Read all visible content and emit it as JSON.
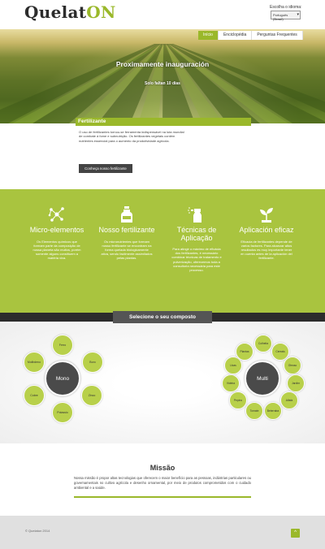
{
  "header": {
    "logo_prefix": "Quelat",
    "logo_suffix": "ON",
    "language_label": "Escolha o idioma:",
    "language_selected": "Português (Brasil)"
  },
  "nav": {
    "items": [
      {
        "label": "Início",
        "active": true
      },
      {
        "label": "Enciclopédia",
        "active": false
      },
      {
        "label": "Perguntas Frequentes",
        "active": false
      }
    ]
  },
  "hero": {
    "title": "Proximamente inauguración",
    "subtitle": "Solo faltan 10 días"
  },
  "fertilizante": {
    "title": "Fertilizante",
    "text": "O uso de fertilizantes tornou-se ferramenta indispensável na luta mundial de combate à fome e subnutrição. Os fertilizantes vegetais contém nutrientes essencial para o aumento da produtividade agrícola.",
    "button": "Conheça nosso fertilizante"
  },
  "features": [
    {
      "icon": "molecule-icon",
      "title": "Micro-elementos",
      "text": "Os Elementos químicos que formam parte da composição de nossa planeta são muitos, porém somente alguns constituem a matéria viva."
    },
    {
      "icon": "bottle-icon",
      "title": "Nosso fertilizante",
      "text": "Os micronutrientes que formam nosso fertilizante se encontram na forma quelada biologicamente ativa, sendo facilmente assimilados pelas plantas."
    },
    {
      "icon": "spray-icon",
      "title": "Técnicas de Aplicação",
      "text": "Para atingir o máximo de eficácia dos fertilizantes, é necessário combinar técnicas de tratamento e pulverização, oferecemos toda a consultoria necessária para este processo."
    },
    {
      "icon": "plant-icon",
      "title": "Aplicación eficaz",
      "text": "Eficacia de fertilizantes depende de varios factores. Para alcanzar altos resultados es muy importante tener en cuenta antes de la aplicación del fertilizante."
    }
  ],
  "compose": {
    "title": "Selecione o seu composto",
    "mono": {
      "label": "Mono",
      "items": [
        "Ferro",
        "Boro",
        "Zinco",
        "Potassio",
        "Cobre",
        "Molibdeno"
      ]
    },
    "multi": {
      "label": "Multi",
      "items": [
        "Colheita",
        "Cereais",
        "Oleoso",
        "Jardim",
        "Alfafa",
        "Beterraba",
        "Tomate",
        "Pepino",
        "Videira",
        "Uvas",
        "Plantas"
      ]
    }
  },
  "mission": {
    "title": "Missão",
    "text": "Nossa missão é propor altas tecnologias que oferecem o maior benefício para as pessoas, indústrias particulares ou governamentais no cultivo agrícola e desenho ornamental, por meio de produtos comprometidos com o cuidado ambiental e a saúde."
  },
  "footer": {
    "copyright": "© Quelaton 2014",
    "top_button": "^"
  },
  "colors": {
    "accent": "#9ab82a",
    "feature_bg": "#a9c43f",
    "dark": "#2c2c2c"
  }
}
